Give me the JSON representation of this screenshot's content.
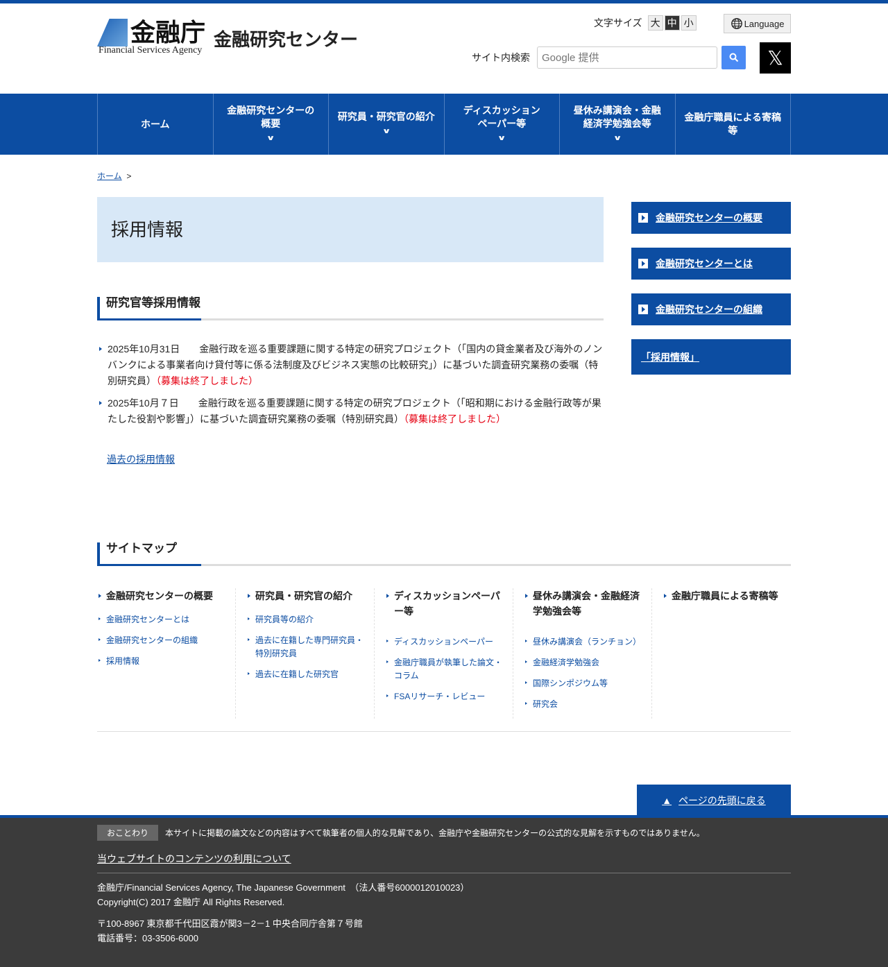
{
  "header": {
    "logo_kanji": "金融庁",
    "logo_en": "Financial Services Agency",
    "center_name": "金融研究センター",
    "font_size_label": "文字サイズ",
    "font_sizes": [
      "大",
      "中",
      "小"
    ],
    "language": "Language",
    "search_label": "サイト内検索",
    "search_placeholder": "Google 提供",
    "x_label": "𝕏"
  },
  "nav": [
    {
      "label": "ホーム"
    },
    {
      "label": "金融研究センターの概要"
    },
    {
      "label": "研究員・研究官の紹介"
    },
    {
      "label": "ディスカッションペーパー等"
    },
    {
      "label": "昼休み講演会・金融経済学勉強会等"
    },
    {
      "label": "金融庁職員による寄稿等"
    }
  ],
  "breadcrumb": {
    "home": "ホーム",
    "sep": ">"
  },
  "page_title": "採用情報",
  "section_title": "研究官等採用情報",
  "news": [
    {
      "date": "2025年10月31日",
      "text": "金融行政を巡る重要課題に関する特定の研究プロジェクト（「国内の貸金業者及び海外のノンバンクによる事業者向け貸付等に係る法制度及びビジネス実態の比較研究」）に基づいた調査研究業務の委嘱（特別研究員）",
      "status": "（募集は終了しました）"
    },
    {
      "date": "2025年10月７日",
      "text": "金融行政を巡る重要課題に関する特定の研究プロジェクト（「昭和期における金融行政等が果たした役割や影響」）に基づいた調査研究業務の委嘱（特別研究員）",
      "status": "（募集は終了しました）"
    }
  ],
  "past_link": "過去の採用情報",
  "side": [
    "金融研究センターの概要",
    "金融研究センターとは",
    "金融研究センターの組織",
    "「採用情報」"
  ],
  "sitemap": {
    "title": "サイトマップ",
    "cols": [
      {
        "head": "金融研究センターの概要",
        "links": [
          "金融研究センターとは",
          "金融研究センターの組織",
          "採用情報"
        ]
      },
      {
        "head": "研究員・研究官の紹介",
        "links": [
          "研究員等の紹介",
          "過去に在籍した専門研究員・特別研究員",
          "過去に在籍した研究官"
        ]
      },
      {
        "head": "ディスカッションペーパー等",
        "links": [
          "ディスカッションペーパー",
          "金融庁職員が執筆した論文・コラム",
          "FSAリサーチ・レビュー"
        ]
      },
      {
        "head": "昼休み講演会・金融経済学勉強会等",
        "links": [
          "昼休み講演会（ランチョン）",
          "金融経済学勉強会",
          "国際シンポジウム等",
          "研究会"
        ]
      },
      {
        "head": "金融庁職員による寄稿等",
        "links": []
      }
    ]
  },
  "to_top": "ページの先頭に戻る",
  "footer": {
    "note_tag": "おことわり",
    "note": "本サイトに掲載の論文などの内容はすべて執筆者の個人的な見解であり、金融庁や金融研究センターの公式的な見解を示すものではありません。",
    "terms": "当ウェブサイトのコンテンツの利用について",
    "org": "金融庁/Financial Services Agency, The Japanese Government　（法人番号6000012010023）",
    "copyright": "Copyright(C) 2017 金融庁 All Rights Reserved.",
    "address": "〒100-8967 東京都千代田区霞が関3－2－1 中央合同庁舎第７号館",
    "phone": "電話番号：03-3506-6000"
  }
}
